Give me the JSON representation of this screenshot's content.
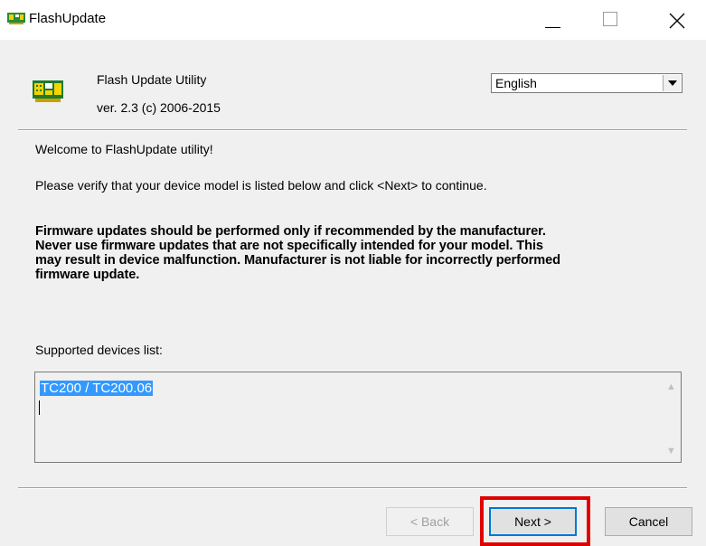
{
  "window": {
    "title": "FlashUpdate"
  },
  "header": {
    "utility_name": "Flash Update Utility",
    "version": "ver. 2.3  (c) 2006-2015",
    "language": {
      "selected": "English"
    }
  },
  "content": {
    "welcome": "Welcome to FlashUpdate utility!",
    "instruction": "Please verify that your device model is listed below and click <Next> to continue.",
    "warning_lines": [
      "Firmware updates should be performed only if recommended by the manufacturer.",
      "Never use firmware updates that are not specifically intended for your model. This",
      "may result in device malfunction. Manufacturer is not liable for incorrectly performed",
      "firmware update."
    ],
    "devices_label": "Supported devices list:",
    "devices": [
      "TC200 / TC200.06"
    ]
  },
  "buttons": {
    "back": "< Back",
    "next": "Next >",
    "cancel": "Cancel"
  },
  "icons": {
    "app": "circuit-board-icon",
    "close": "close-icon",
    "minimize": "minimize-icon",
    "maximize": "maximize-icon"
  },
  "colors": {
    "highlight": "#e10000",
    "selection": "#3399ff",
    "default_button_border": "#0078d7"
  }
}
